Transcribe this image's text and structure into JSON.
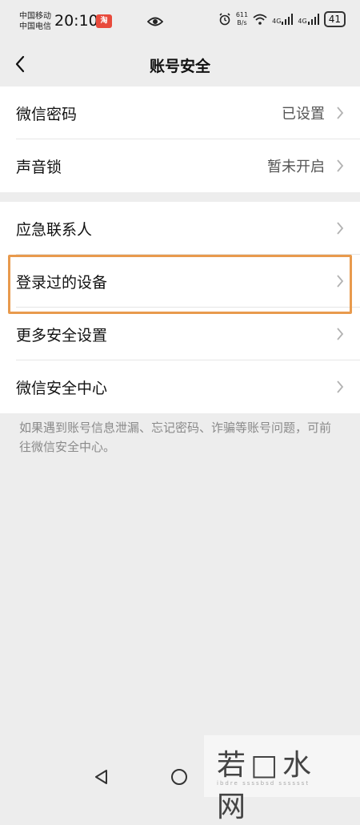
{
  "status_bar": {
    "carrier1": "中国移动",
    "carrier2": "中国电信",
    "time": "20:10",
    "app_badge": "淘",
    "speed_value": "611",
    "speed_unit": "B/s",
    "net1": "4G",
    "net2": "4G",
    "battery": "41"
  },
  "nav": {
    "title": "账号安全"
  },
  "group1": [
    {
      "label": "微信密码",
      "value": "已设置"
    },
    {
      "label": "声音锁",
      "value": "暂未开启"
    }
  ],
  "group2": [
    {
      "label": "应急联系人"
    },
    {
      "label": "登录过的设备"
    },
    {
      "label": "更多安全设置"
    },
    {
      "label": "微信安全中心"
    }
  ],
  "note": "如果遇到账号信息泄漏、忘记密码、诈骗等账号问题，可前往微信安全中心。",
  "watermark": {
    "text": "若□水 网",
    "sub": "ibdre  ssssbsd  sssssst"
  },
  "colors": {
    "highlight": "#e89a4d",
    "background": "#ededed"
  }
}
